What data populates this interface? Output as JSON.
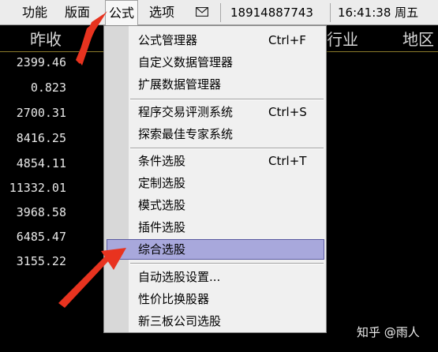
{
  "menubar": {
    "items": [
      "功能",
      "版面",
      "公式",
      "选项"
    ],
    "phone": "18914887743",
    "time": "16:41:38 周五",
    "mail_icon": "envelope-icon"
  },
  "table": {
    "headers": [
      "昨收",
      "细分行业",
      "地区"
    ],
    "prev_close": [
      "2399.46",
      "0.823",
      "2700.31",
      "8416.25",
      "4854.11",
      "11332.01",
      "3968.58",
      "6485.47",
      "3155.22"
    ]
  },
  "menu": {
    "items": [
      {
        "label": "公式管理器",
        "shortcut": "Ctrl+F"
      },
      {
        "label": "自定义数据管理器",
        "shortcut": ""
      },
      {
        "label": "扩展数据管理器",
        "shortcut": ""
      },
      {
        "label": "程序交易评测系统",
        "shortcut": "Ctrl+S"
      },
      {
        "label": "探索最佳专家系统",
        "shortcut": ""
      },
      {
        "label": "条件选股",
        "shortcut": "Ctrl+T"
      },
      {
        "label": "定制选股",
        "shortcut": ""
      },
      {
        "label": "模式选股",
        "shortcut": ""
      },
      {
        "label": "插件选股",
        "shortcut": ""
      },
      {
        "label": "综合选股",
        "shortcut": ""
      },
      {
        "label": "自动选股设置...",
        "shortcut": ""
      },
      {
        "label": "性价比换股器",
        "shortcut": ""
      },
      {
        "label": "新三板公司选股",
        "shortcut": ""
      }
    ],
    "highlighted": "综合选股"
  },
  "watermark": "知乎 @雨人",
  "colors": {
    "highlight": "#a8a8dc",
    "arrow": "#e8331f",
    "background": "#000000"
  }
}
